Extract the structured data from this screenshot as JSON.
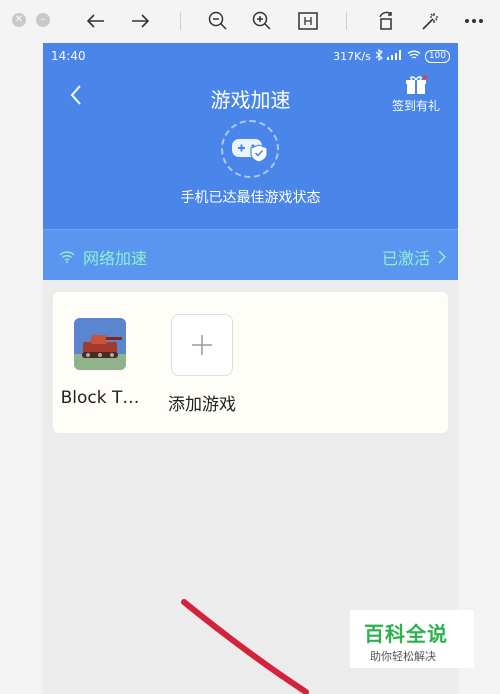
{
  "viewer": {
    "icons": [
      "close-icon",
      "minimize-icon",
      "arrow-left-icon",
      "arrow-right-icon",
      "zoom-out-icon",
      "zoom-in-icon",
      "fit-icon",
      "rotate-icon",
      "magic-wand-icon",
      "more-icon"
    ]
  },
  "status_bar": {
    "time": "14:40",
    "speed": "317K/s",
    "battery": "100"
  },
  "header": {
    "title": "游戏加速",
    "gift_label": "签到有礼",
    "subtitle": "手机已达最佳游戏状态"
  },
  "network": {
    "label": "网络加速",
    "status": "已激活"
  },
  "games": [
    {
      "name": "Block T…"
    },
    {
      "name": "添加游戏"
    }
  ],
  "watermark": {
    "title": "百科全说",
    "subtitle": "助你轻松解决"
  },
  "colors": {
    "header_blue": "#4a86ea",
    "accent_green": "#8ff0d2"
  }
}
